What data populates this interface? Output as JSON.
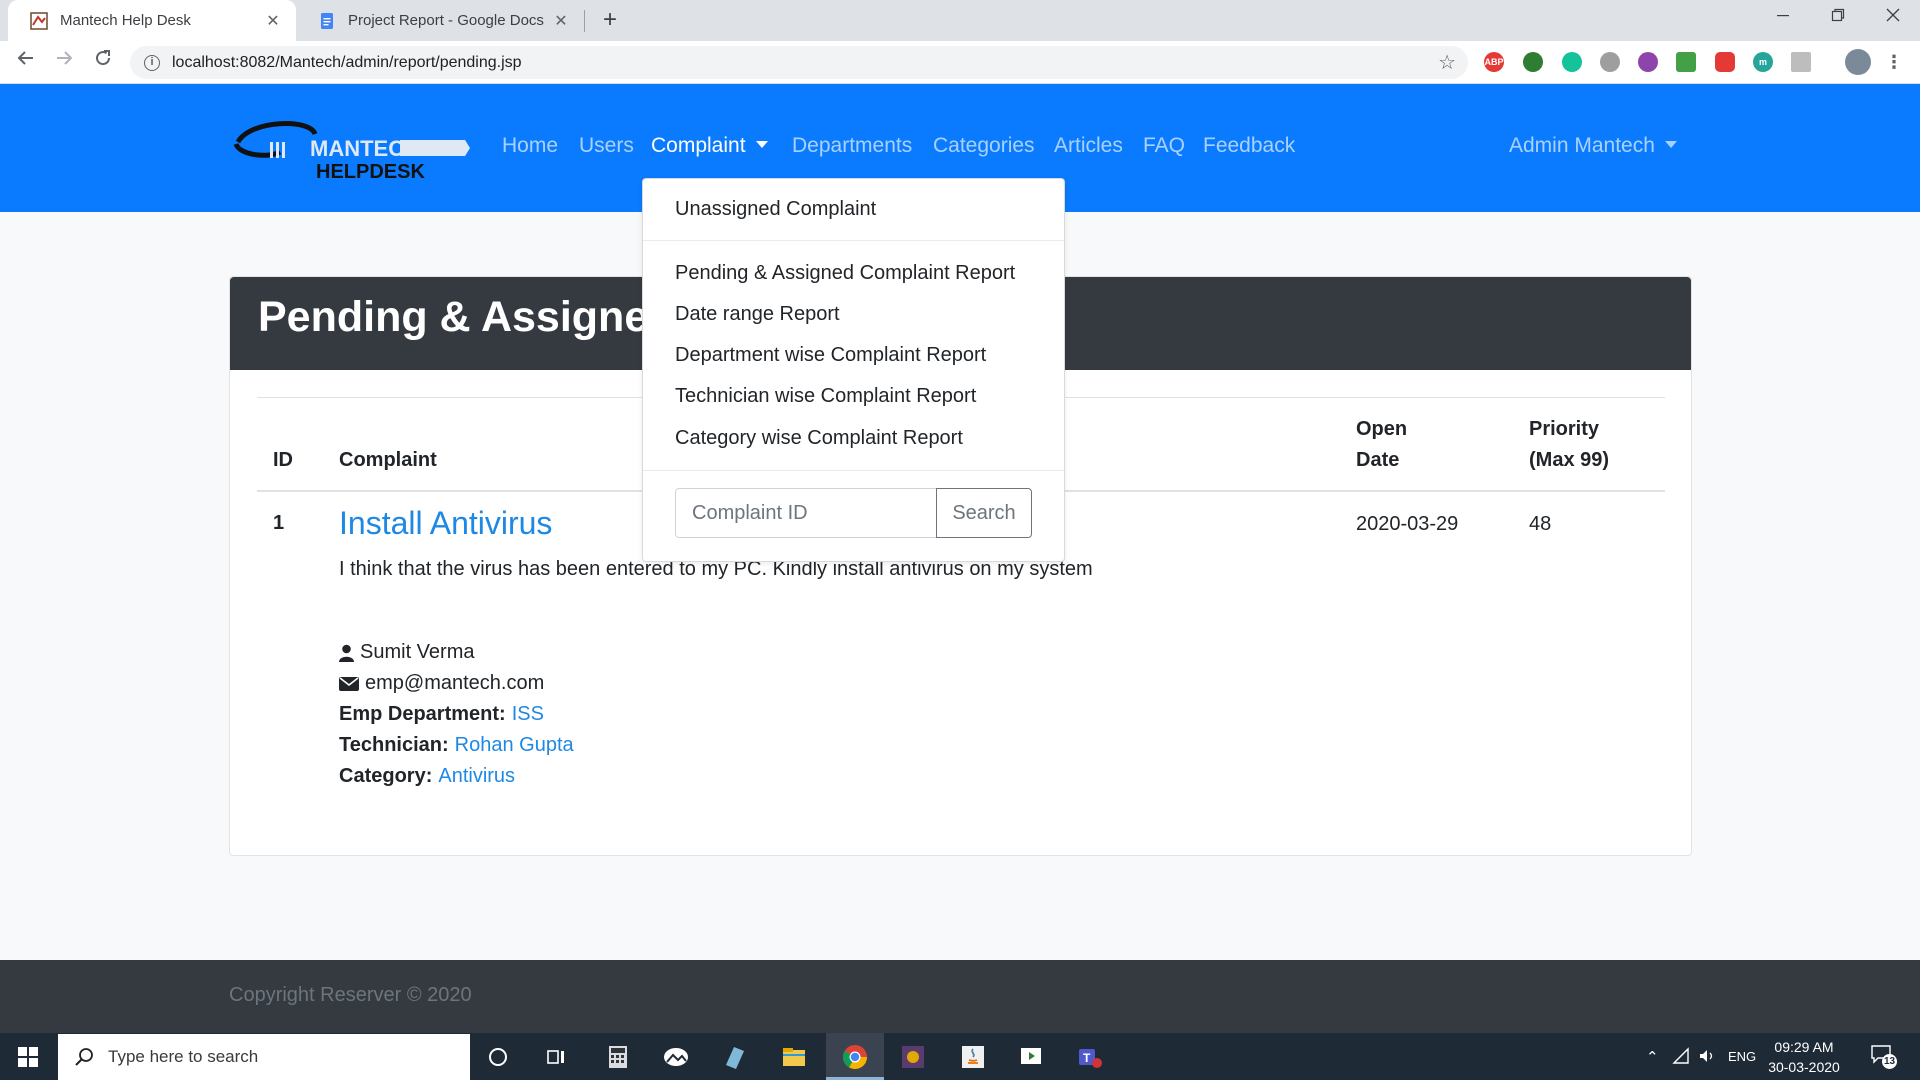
{
  "browser": {
    "tabs": [
      {
        "title": "Mantech Help Desk",
        "active": true
      },
      {
        "title": "Project Report - Google Docs",
        "active": false
      }
    ],
    "close_glyph": "✕",
    "new_tab_glyph": "+",
    "url": "localhost:8082/Mantech/admin/report/pending.jsp",
    "extensions": [
      "ABP",
      "m"
    ]
  },
  "navbar": {
    "logo_text_1": "MANTECH",
    "logo_text_2": "HELPDESK",
    "links": [
      {
        "label": "Home"
      },
      {
        "label": "Users"
      },
      {
        "label": "Complaint",
        "active": true
      },
      {
        "label": "Departments"
      },
      {
        "label": "Categories"
      },
      {
        "label": "Articles"
      },
      {
        "label": "FAQ"
      },
      {
        "label": "Feedback"
      }
    ],
    "user_menu": "Admin Mantech"
  },
  "dropdown": {
    "items": [
      "Unassigned Complaint",
      "Pending & Assigned Complaint Report",
      "Date range Report",
      "Department wise Complaint Report",
      "Technician wise Complaint Report",
      "Category wise Complaint Report"
    ],
    "search_placeholder": "Complaint ID",
    "search_button": "Search"
  },
  "page": {
    "title": "Pending & Assigned Complaint Report",
    "columns": {
      "id": "ID",
      "complaint": "Complaint",
      "open_date_1": "Open",
      "open_date_2": "Date",
      "priority_1": "Priority",
      "priority_2": "(Max 99)"
    },
    "rows": [
      {
        "id": "1",
        "title": "Install Antivirus",
        "description": "I think that the virus has been entered to my PC. Kindly install antivirus on my system",
        "open_date": "2020-03-29",
        "priority": "48",
        "employee": "Sumit Verma",
        "email": "emp@mantech.com",
        "dept_label": "Emp Department:",
        "dept": "ISS",
        "tech_label": "Technician:",
        "technician": "Rohan Gupta",
        "cat_label": "Category:",
        "category": "Antivirus"
      }
    ]
  },
  "footer": {
    "text": "Copyright Reserver © 2020"
  },
  "taskbar": {
    "search_placeholder": "Type here to search",
    "lang": "ENG",
    "time": "09:29 AM",
    "date": "30-03-2020",
    "notifications": "13"
  },
  "colors": {
    "navbar": "#0a7bff",
    "card_header": "#343a40",
    "link": "#1e88e5",
    "footer": "#343a40"
  }
}
